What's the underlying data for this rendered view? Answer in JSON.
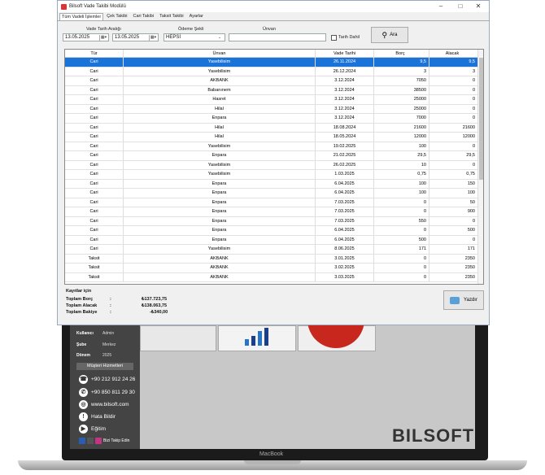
{
  "window": {
    "title": "Bilsoft Vade Takibi Modülü",
    "controls": [
      "–",
      "□",
      "✕"
    ]
  },
  "tabs": [
    {
      "label": "Tüm Vadeli İşlemler",
      "active": true
    },
    {
      "label": "Çek Takibi",
      "active": false
    },
    {
      "label": "Cari Takibi",
      "active": false
    },
    {
      "label": "Taksit Takibi",
      "active": false
    },
    {
      "label": "Ayarlar",
      "active": false
    }
  ],
  "filters": {
    "date_range_label": "Vade Tarih Aralığı",
    "date_from": "13.05.2025",
    "date_to": "13.05.2025",
    "payment_label": "Ödeme Şekli",
    "payment_value": "HEPSİ",
    "title_label": "Ünvan",
    "title_value": "",
    "include_date_label": "Tarih Dahil",
    "search_button": "Ara"
  },
  "table": {
    "columns": [
      "Tür",
      "Ünvan",
      "Vade Tarihi",
      "Borç",
      "Alacak"
    ],
    "rows": [
      [
        "Cari",
        "Yasebilisim",
        "26.11.2024",
        "9,5",
        "9,5"
      ],
      [
        "Cari",
        "Yasebilisim",
        "26.12.2024",
        "3",
        "3"
      ],
      [
        "Cari",
        "AKBANK",
        "3.12.2024",
        "7050",
        "0"
      ],
      [
        "Cari",
        "Babanınem",
        "3.12.2024",
        "38500",
        "0"
      ],
      [
        "Cari",
        "Hasret",
        "3.12.2024",
        "25000",
        "0"
      ],
      [
        "Cari",
        "Hilal",
        "3.12.2024",
        "25000",
        "0"
      ],
      [
        "Cari",
        "Enpara",
        "3.12.2024",
        "7000",
        "0"
      ],
      [
        "Cari",
        "Hilal",
        "18.08.2024",
        "21600",
        "21600"
      ],
      [
        "Cari",
        "Hilal",
        "18.05.2024",
        "12000",
        "12000"
      ],
      [
        "Cari",
        "Yasebilisim",
        "19.02.2025",
        "100",
        "0"
      ],
      [
        "Cari",
        "Enpara",
        "21.02.2025",
        "29,5",
        "29,5"
      ],
      [
        "Cari",
        "Yasebilisim",
        "26.02.2025",
        "10",
        "0"
      ],
      [
        "Cari",
        "Yasebilisim",
        "1.03.2025",
        "0,75",
        "0,75"
      ],
      [
        "Cari",
        "Enpara",
        "6.04.2025",
        "100",
        "150"
      ],
      [
        "Cari",
        "Enpara",
        "6.04.2025",
        "100",
        "100"
      ],
      [
        "Cari",
        "Enpara",
        "7.03.2025",
        "0",
        "50"
      ],
      [
        "Cari",
        "Enpara",
        "7.03.2025",
        "0",
        "900"
      ],
      [
        "Cari",
        "Enpara",
        "7.03.2025",
        "550",
        "0"
      ],
      [
        "Cari",
        "Enpara",
        "6.04.2025",
        "0",
        "500"
      ],
      [
        "Cari",
        "Enpara",
        "6.04.2025",
        "500",
        "0"
      ],
      [
        "Cari",
        "Yasebilisim",
        "8.06.2025",
        "171",
        "171"
      ],
      [
        "Taksit",
        "AKBANK",
        "3.01.2025",
        "0",
        "2350"
      ],
      [
        "Taksit",
        "AKBANK",
        "3.02.2025",
        "0",
        "2350"
      ],
      [
        "Taksit",
        "AKBANK",
        "3.03.2025",
        "0",
        "2350"
      ]
    ],
    "selected_row": 0
  },
  "summary": {
    "records_label": "Kayıtlar için",
    "total_debt_label": "Toplam Borç",
    "total_debt": "₺137.723,75",
    "total_credit_label": "Toplam Alacak",
    "total_credit": "₺138.063,75",
    "total_balance_label": "Toplam Bakiye",
    "total_balance": "-₺340,00",
    "print_button": "Yazdır"
  },
  "background_app": {
    "user_label": "Kullanıcı",
    "user_value": "Admin",
    "branch_label": "Şube",
    "branch_value": "Merkez",
    "period_label": "Dönem",
    "period_value": "2025",
    "support_title": "Müşteri Hizmetleri",
    "phone1": "+90 212 912 24 26",
    "phone2": "+90 850 811 29 30",
    "website": "www.bilsoft.com",
    "report_bug": "Hata Bildir",
    "training": "Eğitim",
    "follow": "Bizi Takip Edin",
    "brand": "BILSOFT",
    "device_label": "MacBook"
  },
  "colors": {
    "selection": "#1a73d9",
    "brand_red": "#c8271e"
  }
}
